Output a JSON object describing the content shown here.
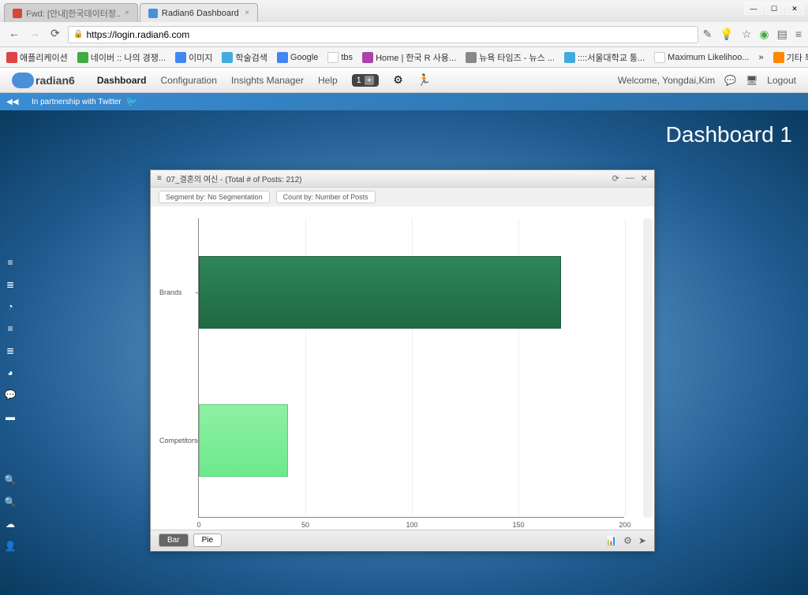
{
  "browser": {
    "tabs": [
      {
        "label": "Fwd: [안내]한국데이터정..",
        "icon": "gmail"
      },
      {
        "label": "Radian6 Dashboard",
        "icon": "radian"
      }
    ],
    "url": "https://login.radian6.com",
    "bookmarks": [
      {
        "label": "애플리케이션",
        "icon": "red"
      },
      {
        "label": "네이버 :: 나의 경쟁...",
        "icon": "green"
      },
      {
        "label": "이미지",
        "icon": "blue"
      },
      {
        "label": "학술검색",
        "icon": "cyan"
      },
      {
        "label": "Google",
        "icon": "blue"
      },
      {
        "label": "tbs",
        "icon": "doc"
      },
      {
        "label": "Home | 한국 R 사용...",
        "icon": "purple"
      },
      {
        "label": "뉴욕 타임즈 - 뉴스 ...",
        "icon": "gray"
      },
      {
        "label": "::::서울대학교 통...",
        "icon": "cyan"
      },
      {
        "label": "Maximum Likelihoo...",
        "icon": "doc"
      },
      {
        "label": "기타 북마크",
        "icon": "orange"
      }
    ]
  },
  "header": {
    "logo": "radian6",
    "nav": {
      "dashboard": "Dashboard",
      "configuration": "Configuration",
      "insights": "Insights Manager",
      "help": "Help"
    },
    "welcome": "Welcome, Yongdai,Kim",
    "logout": "Logout",
    "page": "1"
  },
  "partner": {
    "text": "In partnership with Twitter"
  },
  "dashboard": {
    "title": "Dashboard 1"
  },
  "widget": {
    "title": "07_결혼의 여신 - (Total # of Posts: 212)",
    "filters": {
      "segment": "Segment by: No Segmentation",
      "count": "Count by: Number of Posts"
    },
    "chart_types": {
      "bar": "Bar",
      "pie": "Pie"
    }
  },
  "chart_data": {
    "type": "bar",
    "orientation": "horizontal",
    "categories": [
      "Brands",
      "Competitors"
    ],
    "values": [
      170,
      42
    ],
    "xlabel": "",
    "ylabel": "",
    "xlim": [
      0,
      200
    ],
    "x_ticks": [
      0,
      50,
      100,
      150,
      200
    ],
    "colors": [
      "#2d8659",
      "#6ee88c"
    ]
  }
}
